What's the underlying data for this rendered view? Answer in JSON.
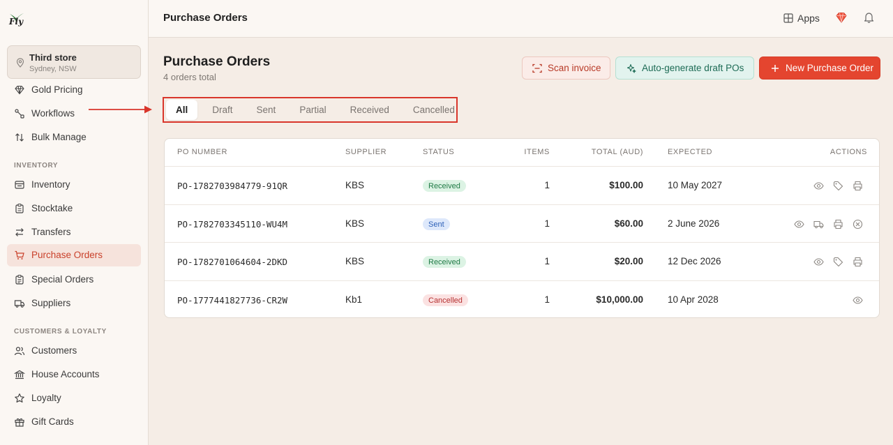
{
  "sidebar": {
    "logo_text": "Fly",
    "store": {
      "name": "Third store",
      "location": "Sydney, NSW"
    },
    "items": [
      {
        "label": "Gold Pricing",
        "icon": "diamond-icon"
      },
      {
        "label": "Workflows",
        "icon": "workflow-icon"
      },
      {
        "label": "Bulk Manage",
        "icon": "sort-arrows-icon"
      }
    ],
    "inventory_section": "INVENTORY",
    "inventory_items": [
      {
        "label": "Inventory",
        "icon": "archive-icon"
      },
      {
        "label": "Stocktake",
        "icon": "clipboard-icon"
      },
      {
        "label": "Transfers",
        "icon": "transfer-icon"
      },
      {
        "label": "Purchase Orders",
        "icon": "cart-icon",
        "active": true
      },
      {
        "label": "Special Orders",
        "icon": "clipboard-list-icon"
      },
      {
        "label": "Suppliers",
        "icon": "truck-icon"
      }
    ],
    "customers_section": "CUSTOMERS & LOYALTY",
    "customer_items": [
      {
        "label": "Customers",
        "icon": "users-icon"
      },
      {
        "label": "House Accounts",
        "icon": "bank-icon"
      },
      {
        "label": "Loyalty",
        "icon": "star-icon"
      },
      {
        "label": "Gift Cards",
        "icon": "gift-icon"
      }
    ]
  },
  "header": {
    "title": "Purchase Orders",
    "apps_label": "Apps"
  },
  "page": {
    "title": "Purchase Orders",
    "subtitle": "4 orders total",
    "scan_label": "Scan invoice",
    "auto_label": "Auto-generate draft POs",
    "new_label": "New Purchase Order"
  },
  "tabs": [
    "All",
    "Draft",
    "Sent",
    "Partial",
    "Received",
    "Cancelled"
  ],
  "table": {
    "headers": {
      "po": "PO NUMBER",
      "supplier": "SUPPLIER",
      "status": "STATUS",
      "items": "ITEMS",
      "total": "TOTAL (AUD)",
      "expected": "EXPECTED",
      "actions": "ACTIONS"
    },
    "rows": [
      {
        "po": "PO-1782703984779-91QR",
        "supplier": "KBS",
        "status": "Received",
        "items": "1",
        "total": "$100.00",
        "expected": "10 May 2027",
        "actions": [
          "eye-icon",
          "tag-icon",
          "printer-icon"
        ]
      },
      {
        "po": "PO-1782703345110-WU4M",
        "supplier": "KBS",
        "status": "Sent",
        "items": "1",
        "total": "$60.00",
        "expected": "2 June 2026",
        "actions": [
          "eye-icon",
          "truck-icon",
          "printer-icon",
          "cancel-circle-icon"
        ]
      },
      {
        "po": "PO-1782701064604-2DKD",
        "supplier": "KBS",
        "status": "Received",
        "items": "1",
        "total": "$20.00",
        "expected": "12 Dec 2026",
        "actions": [
          "eye-icon",
          "tag-icon",
          "printer-icon"
        ]
      },
      {
        "po": "PO-1777441827736-CR2W",
        "supplier": "Kb1",
        "status": "Cancelled",
        "items": "1",
        "total": "$10,000.00",
        "expected": "10 Apr 2028",
        "actions": [
          "eye-icon"
        ]
      }
    ]
  },
  "colors": {
    "accent": "#e4452f",
    "annotation": "#d9362b",
    "received": "#1f7a45",
    "sent": "#2c5fb7",
    "cancelled": "#b63131"
  }
}
